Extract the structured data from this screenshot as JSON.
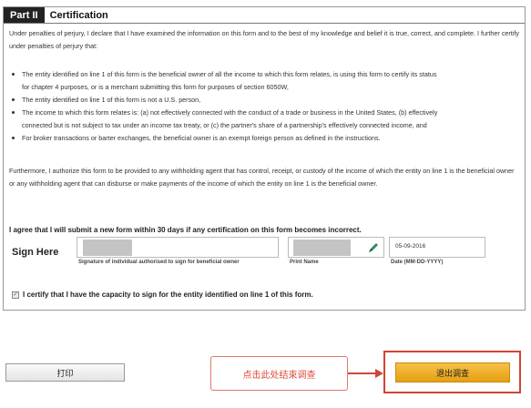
{
  "part": {
    "tag": "Part II",
    "title": "Certification"
  },
  "paragraph1": "Under penalties of perjury, I declare that I have examined the information on this form and to the best of my knowledge and belief it is true, correct, and complete. I further certify under penalties of perjury that:",
  "bullets": [
    {
      "lines": [
        "The entity identified on line 1 of this form is the beneficial owner of all the income to which this form relates, is using this form to certify its status",
        "for chapter 4 purposes, or is a merchant submitting this form for purposes of section 6050W,"
      ]
    },
    {
      "lines": [
        "The entity identified on line 1 of this form is not a U.S. person,"
      ]
    },
    {
      "lines": [
        "The income to which this form relates is: (a) not effectively connected with the conduct of a trade or business in the United States, (b) effectively",
        "connected but is not subject to tax under an income tax treaty, or (c) the partner's share of a partnership's effectively connected income, and"
      ]
    },
    {
      "lines": [
        "For broker transactions or barter exchanges, the beneficial owner is an exempt foreign person as defined in the instructions."
      ]
    }
  ],
  "paragraph2": "Furthermore, I authorize this form to be provided to any withholding agent that has control, receipt, or custody of the income of which the entity on line 1 is the beneficial owner or any withholding agent that can disburse or make payments of the income of which the entity on line 1 is the beneficial owner.",
  "agree_text": "I agree that I will submit a new form within 30 days if any certification on this form becomes incorrect.",
  "sign": {
    "label": "Sign Here",
    "signature_caption": "Signature of individual authorised to sign for beneficial owner",
    "print_name_caption": "Print Name",
    "date_caption": "Date (MM-DD-YYYY)",
    "date_value": "05-09-2016"
  },
  "capacity_text": "I certify that I have the capacity to sign for the entity identified on line 1 of this form.",
  "buttons": {
    "print": "打印",
    "exit": "退出调查"
  },
  "callout_text": "点击此处结束调查",
  "colors": {
    "accent_red": "#d04535",
    "exit_button": "#f0b030"
  },
  "icons": {
    "pen": "pen-icon",
    "arrow": "arrow-right-icon"
  }
}
